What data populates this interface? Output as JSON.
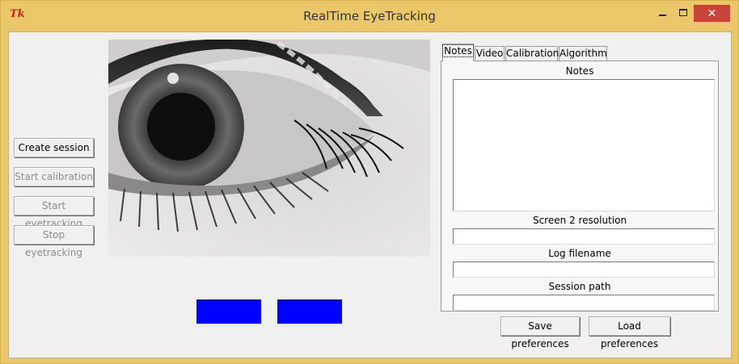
{
  "window": {
    "title": "RealTime EyeTracking",
    "app_icon": "Tk",
    "controls": {
      "minimize": "minimize-icon",
      "maximize": "maximize-icon",
      "close": "✕"
    }
  },
  "left_buttons": [
    {
      "label": "Create session",
      "enabled": true
    },
    {
      "label": "Start calibration",
      "enabled": false
    },
    {
      "label": "Start eyetracking",
      "enabled": false
    },
    {
      "label": "Stop eyetracking",
      "enabled": false
    }
  ],
  "image_preview": {
    "subject": "close-up grayscale eye photo"
  },
  "indicators": {
    "color": "#0000ff"
  },
  "notebook": {
    "tabs": [
      "Notes",
      "Video",
      "Calibration",
      "Algorithm"
    ],
    "active_tab": "Notes",
    "notes_page": {
      "notes_label": "Notes",
      "notes_value": "",
      "screen2_label": "Screen 2 resolution",
      "screen2_value": "",
      "log_label": "Log filename",
      "log_value": "",
      "session_label": "Session path",
      "session_value": ""
    }
  },
  "footer_buttons": {
    "save": "Save preferences",
    "load": "Load preferences"
  },
  "colors": {
    "frame": "#eac86a",
    "client": "#f0f0f0",
    "close_button": "#c7443a",
    "indicator_blue": "#0000ff"
  }
}
